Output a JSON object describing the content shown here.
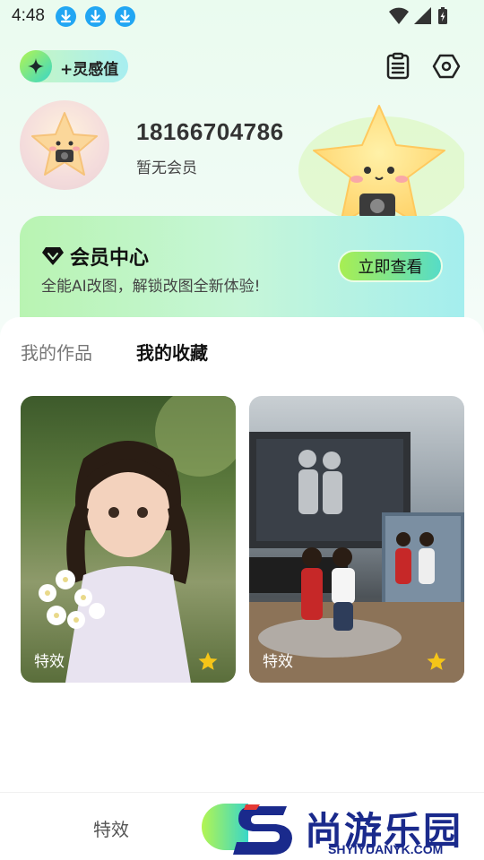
{
  "status_bar": {
    "time": "4:48",
    "icons": [
      "download-icon",
      "download-icon",
      "download-icon",
      "wifi-icon",
      "signal-icon",
      "battery-charging-icon"
    ]
  },
  "header": {
    "inspiration_label": "+灵感值",
    "icons": [
      "clipboard-list-icon",
      "settings-hexagon-icon"
    ]
  },
  "profile": {
    "phone": "18166704786",
    "membership_status": "暂无会员"
  },
  "member_card": {
    "title": "会员中心",
    "subtitle": "全能AI改图，解锁改图全新体验!",
    "button_label": "立即查看"
  },
  "tabs": [
    {
      "label": "我的作品",
      "active": false
    },
    {
      "label": "我的收藏",
      "active": true
    }
  ],
  "favorites": [
    {
      "label": "特效",
      "starred": true
    },
    {
      "label": "特效",
      "starred": true
    }
  ],
  "bottom_nav": {
    "effects_label": "特效"
  },
  "watermark": {
    "brand": "尚游乐园",
    "url": "SHYIYUANYK.COM"
  },
  "colors": {
    "accent_green": "#a8ee52",
    "accent_teal": "#56dcc8",
    "star_yellow": "#f5c518",
    "download_blue": "#21a6f3",
    "watermark_navy": "#1a2a8c"
  }
}
